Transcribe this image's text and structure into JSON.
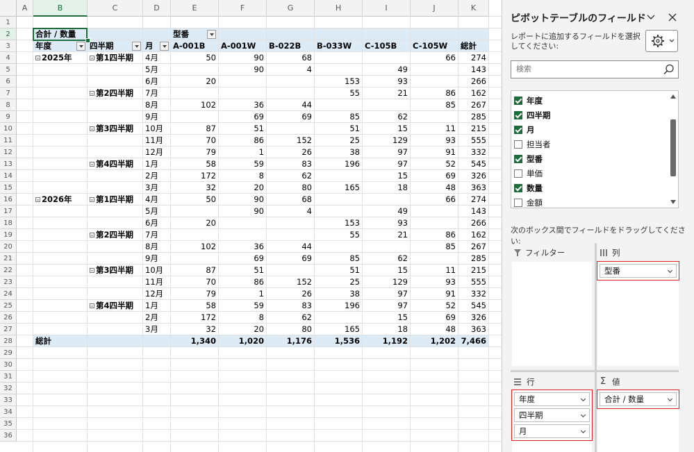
{
  "sheet": {
    "columns": [
      "A",
      "B",
      "C",
      "D",
      "E",
      "F",
      "G",
      "H",
      "I",
      "J",
      "K"
    ],
    "rows": [
      "1",
      "2",
      "3",
      "4",
      "5",
      "6",
      "7",
      "8",
      "9",
      "10",
      "11",
      "12",
      "13",
      "14",
      "15",
      "16",
      "17",
      "18",
      "19",
      "20",
      "21",
      "22",
      "23",
      "24",
      "25",
      "26",
      "27",
      "28",
      "29",
      "30",
      "31",
      "32",
      "33",
      "34",
      "35",
      "36"
    ]
  },
  "pivot": {
    "value_label": "合計 / 数量",
    "col_field": "型番",
    "row_field_year": "年度",
    "row_field_quarter": "四半期",
    "row_field_month": "月",
    "col_items": [
      "A-001B",
      "A-001W",
      "B-022B",
      "B-033W",
      "C-105B",
      "C-105W",
      "総計"
    ],
    "collapse_glyph": "⊟",
    "rows": [
      {
        "year": "2025年",
        "quarter": "第1四半期",
        "month": "4月",
        "v": [
          "50",
          "90",
          "68",
          "",
          "",
          "66",
          "274"
        ]
      },
      {
        "year": "",
        "quarter": "",
        "month": "5月",
        "v": [
          "",
          "90",
          "4",
          "",
          "49",
          "",
          "143"
        ]
      },
      {
        "year": "",
        "quarter": "",
        "month": "6月",
        "v": [
          "20",
          "",
          "",
          "153",
          "93",
          "",
          "266"
        ]
      },
      {
        "year": "",
        "quarter": "第2四半期",
        "month": "7月",
        "v": [
          "",
          "",
          "",
          "55",
          "21",
          "86",
          "162"
        ]
      },
      {
        "year": "",
        "quarter": "",
        "month": "8月",
        "v": [
          "102",
          "36",
          "44",
          "",
          "",
          "85",
          "267"
        ]
      },
      {
        "year": "",
        "quarter": "",
        "month": "9月",
        "v": [
          "",
          "69",
          "69",
          "85",
          "62",
          "",
          "285"
        ]
      },
      {
        "year": "",
        "quarter": "第3四半期",
        "month": "10月",
        "v": [
          "87",
          "51",
          "",
          "51",
          "15",
          "11",
          "215"
        ]
      },
      {
        "year": "",
        "quarter": "",
        "month": "11月",
        "v": [
          "70",
          "86",
          "152",
          "25",
          "129",
          "93",
          "555"
        ]
      },
      {
        "year": "",
        "quarter": "",
        "month": "12月",
        "v": [
          "79",
          "1",
          "26",
          "38",
          "97",
          "91",
          "332"
        ]
      },
      {
        "year": "",
        "quarter": "第4四半期",
        "month": "1月",
        "v": [
          "58",
          "59",
          "83",
          "196",
          "97",
          "52",
          "545"
        ]
      },
      {
        "year": "",
        "quarter": "",
        "month": "2月",
        "v": [
          "172",
          "8",
          "62",
          "",
          "15",
          "69",
          "326"
        ]
      },
      {
        "year": "",
        "quarter": "",
        "month": "3月",
        "v": [
          "32",
          "20",
          "80",
          "165",
          "18",
          "48",
          "363"
        ]
      },
      {
        "year": "2026年",
        "quarter": "第1四半期",
        "month": "4月",
        "v": [
          "50",
          "90",
          "68",
          "",
          "",
          "66",
          "274"
        ]
      },
      {
        "year": "",
        "quarter": "",
        "month": "5月",
        "v": [
          "",
          "90",
          "4",
          "",
          "49",
          "",
          "143"
        ]
      },
      {
        "year": "",
        "quarter": "",
        "month": "6月",
        "v": [
          "20",
          "",
          "",
          "153",
          "93",
          "",
          "266"
        ]
      },
      {
        "year": "",
        "quarter": "第2四半期",
        "month": "7月",
        "v": [
          "",
          "",
          "",
          "55",
          "21",
          "86",
          "162"
        ]
      },
      {
        "year": "",
        "quarter": "",
        "month": "8月",
        "v": [
          "102",
          "36",
          "44",
          "",
          "",
          "85",
          "267"
        ]
      },
      {
        "year": "",
        "quarter": "",
        "month": "9月",
        "v": [
          "",
          "69",
          "69",
          "85",
          "62",
          "",
          "285"
        ]
      },
      {
        "year": "",
        "quarter": "第3四半期",
        "month": "10月",
        "v": [
          "87",
          "51",
          "",
          "51",
          "15",
          "11",
          "215"
        ]
      },
      {
        "year": "",
        "quarter": "",
        "month": "11月",
        "v": [
          "70",
          "86",
          "152",
          "25",
          "129",
          "93",
          "555"
        ]
      },
      {
        "year": "",
        "quarter": "",
        "month": "12月",
        "v": [
          "79",
          "1",
          "26",
          "38",
          "97",
          "91",
          "332"
        ]
      },
      {
        "year": "",
        "quarter": "第4四半期",
        "month": "1月",
        "v": [
          "58",
          "59",
          "83",
          "196",
          "97",
          "52",
          "545"
        ]
      },
      {
        "year": "",
        "quarter": "",
        "month": "2月",
        "v": [
          "172",
          "8",
          "62",
          "",
          "15",
          "69",
          "326"
        ]
      },
      {
        "year": "",
        "quarter": "",
        "month": "3月",
        "v": [
          "32",
          "20",
          "80",
          "165",
          "18",
          "48",
          "363"
        ]
      }
    ],
    "grand_total_label": "総計",
    "grand_total": [
      "1,340",
      "1,020",
      "1,176",
      "1,536",
      "1,192",
      "1,202",
      "7,466"
    ]
  },
  "pane": {
    "title": "ピボットテーブルのフィールド",
    "subtitle": "レポートに追加するフィールドを選択してください:",
    "search_placeholder": "検索",
    "fields": [
      {
        "label": "年度",
        "checked": true
      },
      {
        "label": "四半期",
        "checked": true
      },
      {
        "label": "月",
        "checked": true
      },
      {
        "label": "担当者",
        "checked": false
      },
      {
        "label": "型番",
        "checked": true
      },
      {
        "label": "単価",
        "checked": false
      },
      {
        "label": "数量",
        "checked": true
      },
      {
        "label": "金額",
        "checked": false
      }
    ],
    "drag_hint": "次のボックス間でフィールドをドラッグしてください:",
    "areas": {
      "filter_label": "フィルター",
      "columns_label": "列",
      "rows_label": "行",
      "values_label": "値",
      "columns_items": [
        "型番"
      ],
      "rows_items": [
        "年度",
        "四半期",
        "月"
      ],
      "values_items": [
        "合計 / 数量"
      ]
    },
    "icons": {
      "collapse": "chevron-down-icon",
      "close": "close-icon",
      "settings": "gear-icon",
      "search": "search-icon"
    },
    "highlight_color": "#e0201d",
    "accent": "#1e6b3b"
  }
}
